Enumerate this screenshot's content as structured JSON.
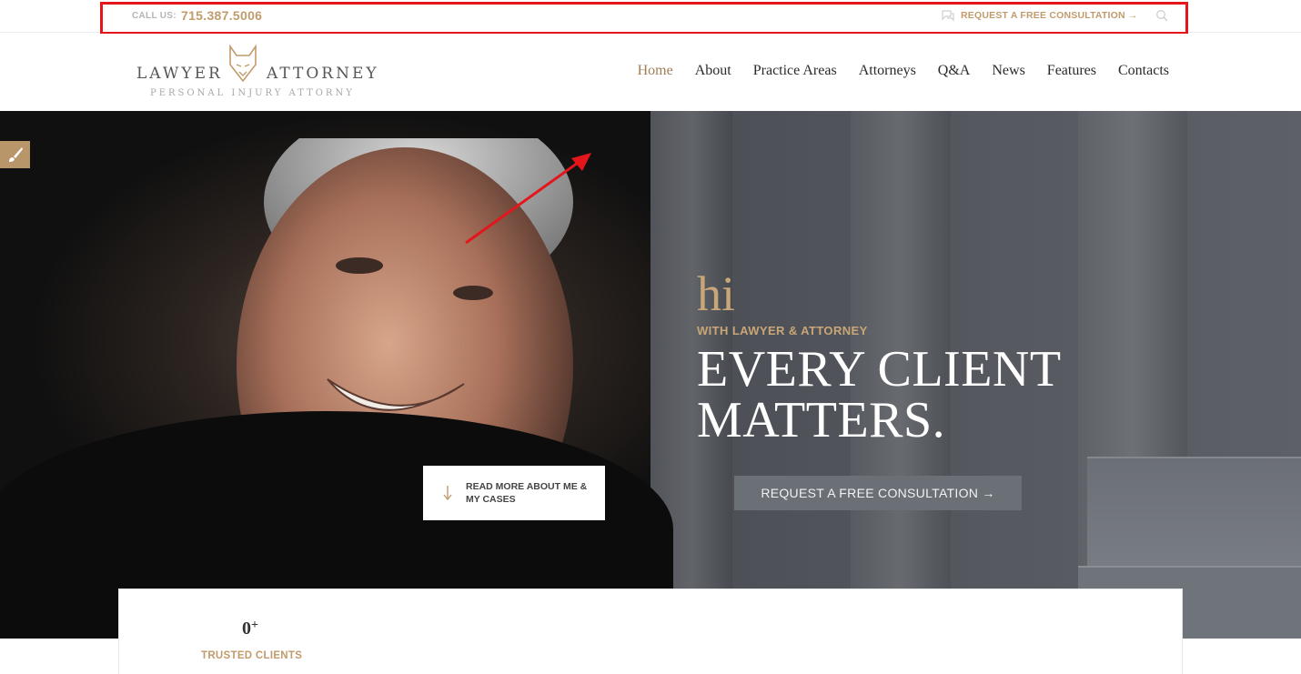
{
  "topbar": {
    "call_label": "CALL US:",
    "phone": "715.387.5006",
    "consult_link": "REQUEST A FREE CONSULTATION →",
    "icons": [
      "chat-icon",
      "search-icon"
    ]
  },
  "logo": {
    "left_word": "LAWYER",
    "right_word": "ATTORNEY",
    "tagline": "PERSONAL INJURY ATTORNY"
  },
  "nav": {
    "items": [
      {
        "label": "Home",
        "active": true
      },
      {
        "label": "About"
      },
      {
        "label": "Practice Areas"
      },
      {
        "label": "Attorneys"
      },
      {
        "label": "Q&A"
      },
      {
        "label": "News"
      },
      {
        "label": "Features"
      },
      {
        "label": "Contacts"
      }
    ]
  },
  "hero": {
    "hi": "hi",
    "subtitle": "WITH LAWYER & ATTORNEY",
    "title": "EVERY CLIENT MATTERS.",
    "cta": "REQUEST A FREE CONSULTATION →",
    "read_more": "READ MORE ABOUT ME & MY CASES"
  },
  "stats": {
    "value": "0",
    "suffix": "+",
    "label": "TRUSTED CLIENTS"
  },
  "colors": {
    "accent": "#c19b6c",
    "highlight": "#e3161b",
    "hero_button": "#6b6f76"
  }
}
